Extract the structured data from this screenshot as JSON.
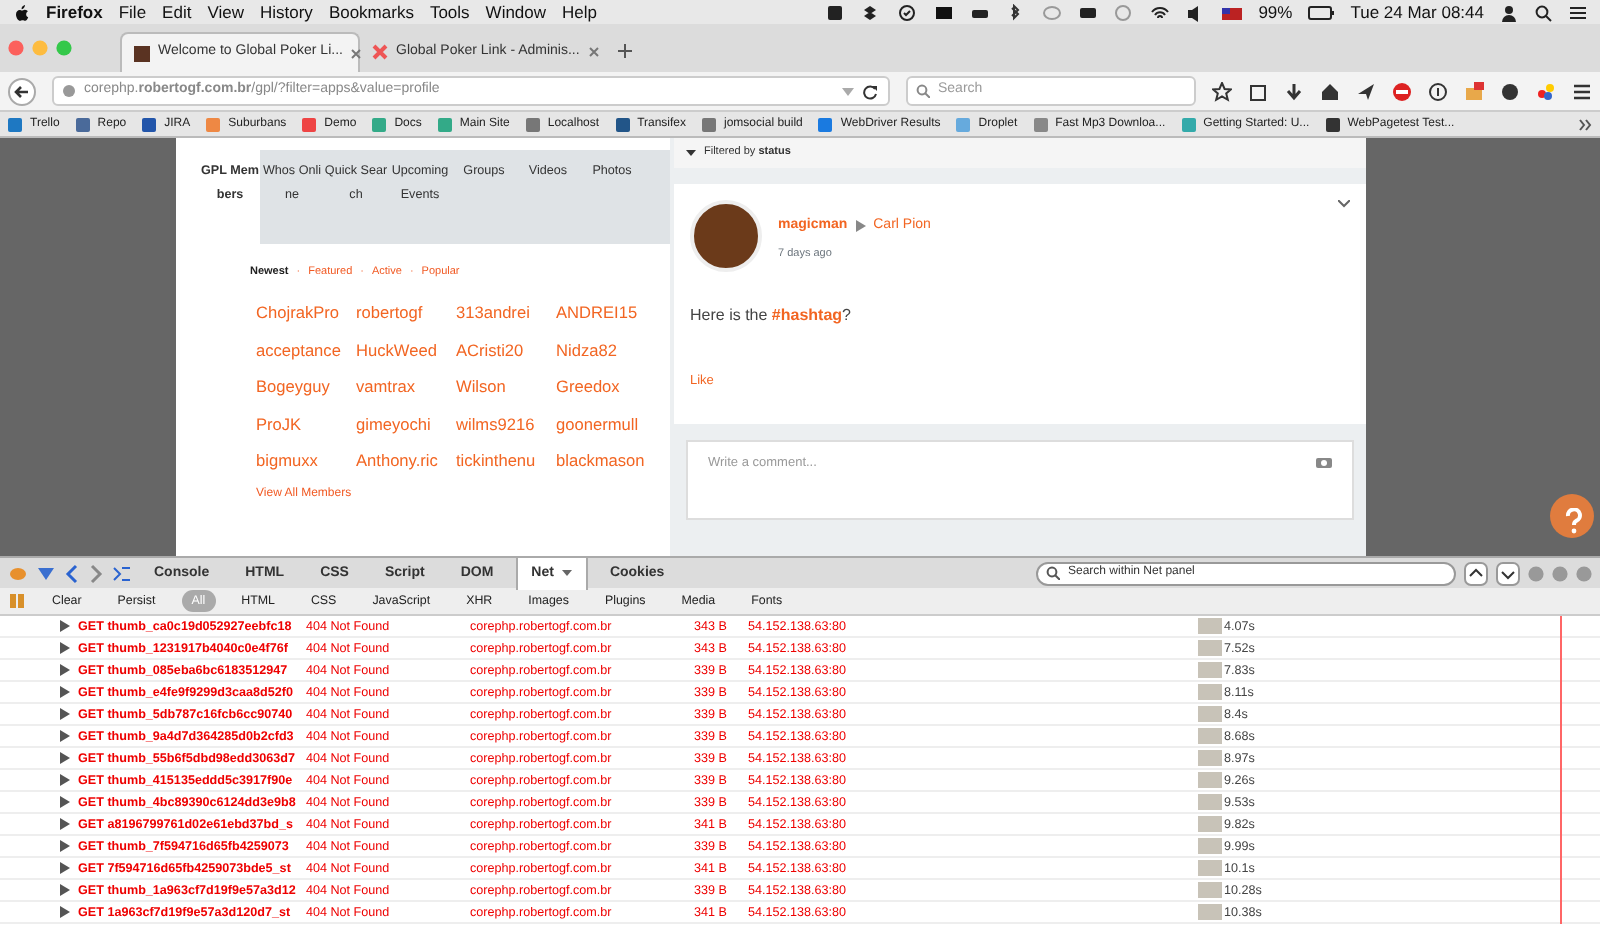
{
  "menu_bar": {
    "app": "Firefox",
    "menus": [
      "File",
      "Edit",
      "View",
      "History",
      "Bookmarks",
      "Tools",
      "Window",
      "Help"
    ],
    "battery": "99%",
    "clock": "Tue 24 Mar  08:44"
  },
  "tabs": [
    {
      "title": "Welcome to Global Poker Li...",
      "selected": true
    },
    {
      "title": "Global Poker Link - Adminis...",
      "selected": false
    }
  ],
  "url_bar": {
    "url": "corephp.**robertogf.com.br**/gpl/?filter=apps&value=profile"
  },
  "search": {
    "placeholder": "Search"
  },
  "bookmarks": [
    "Trello",
    "Repo",
    "JIRA",
    "Suburbans",
    "Demo",
    "Docs",
    "Main Site",
    "Localhost",
    "Transifex",
    "jomsocial build",
    "WebDriver Results",
    "Droplet",
    "Fast Mp3 Downloa...",
    "Getting Started: U...",
    "WebPagetest Test..."
  ],
  "members_panel": {
    "tabs": [
      {
        "label": "GPL Members",
        "selected": true
      },
      {
        "label": "Whos Online",
        "selected": false
      },
      {
        "label": "Quick Search",
        "selected": false
      },
      {
        "label": "Upcoming Events",
        "selected": false
      },
      {
        "label": "Groups",
        "selected": false
      },
      {
        "label": "Videos",
        "selected": false
      },
      {
        "label": "Photos",
        "selected": false
      }
    ],
    "filter_separator": "·",
    "filters": [
      {
        "label": "Newest",
        "selected": true
      },
      {
        "label": "Featured",
        "selected": false
      },
      {
        "label": "Active",
        "selected": false
      },
      {
        "label": "Popular",
        "selected": false
      }
    ],
    "members": [
      "ChojrakPro",
      "robertogf",
      "313andrei",
      "ANDREI15",
      "acceptance",
      "HuckWeed",
      "ACristi20",
      "Nidza82",
      "Bogeyguy",
      "vamtrax",
      "Wilson",
      "Greedox",
      "ProJK",
      "gimeyochi",
      "wilms9216",
      "goonermull",
      "bigmuxx",
      "Anthony.ric",
      "tickinthenu",
      "blackmason"
    ],
    "view_all": "View All Members"
  },
  "feed": {
    "filter_label": "Filtered by **status**",
    "post": {
      "author": "magicman",
      "target": "Carl Pion",
      "time": "7 days ago",
      "text": "Here is the **#hashtag**?",
      "like": "Like"
    },
    "comment_placeholder": "Write a comment..."
  },
  "firebug": {
    "tabs": [
      {
        "label": "Console",
        "selected": false
      },
      {
        "label": "HTML",
        "selected": false
      },
      {
        "label": "CSS",
        "selected": false
      },
      {
        "label": "Script",
        "selected": false
      },
      {
        "label": "DOM",
        "selected": false
      },
      {
        "label": "Net",
        "selected": true
      },
      {
        "label": "Cookies",
        "selected": false
      }
    ],
    "search_placeholder": "Search within Net panel",
    "actions": [
      "Clear",
      "Persist"
    ],
    "types": [
      {
        "label": "All",
        "selected": true
      },
      {
        "label": "HTML",
        "selected": false
      },
      {
        "label": "CSS",
        "selected": false
      },
      {
        "label": "JavaScript",
        "selected": false
      },
      {
        "label": "XHR",
        "selected": false
      },
      {
        "label": "Images",
        "selected": false
      },
      {
        "label": "Plugins",
        "selected": false
      },
      {
        "label": "Media",
        "selected": false
      },
      {
        "label": "Fonts",
        "selected": false
      }
    ]
  },
  "requests": [
    {
      "request": "GET thumb_ca0c19d052927eebfc18",
      "status": "404 Not Found",
      "domain": "corephp.robertogf.com.br",
      "size": "343 B",
      "ip": "54.152.138.63:80",
      "time": "4.07s"
    },
    {
      "request": "GET thumb_1231917b4040c0e4f76f",
      "status": "404 Not Found",
      "domain": "corephp.robertogf.com.br",
      "size": "343 B",
      "ip": "54.152.138.63:80",
      "time": "7.52s"
    },
    {
      "request": "GET thumb_085eba6bc6183512947",
      "status": "404 Not Found",
      "domain": "corephp.robertogf.com.br",
      "size": "339 B",
      "ip": "54.152.138.63:80",
      "time": "7.83s"
    },
    {
      "request": "GET thumb_e4fe9f9299d3caa8d52f0",
      "status": "404 Not Found",
      "domain": "corephp.robertogf.com.br",
      "size": "339 B",
      "ip": "54.152.138.63:80",
      "time": "8.11s"
    },
    {
      "request": "GET thumb_5db787c16fcb6cc90740",
      "status": "404 Not Found",
      "domain": "corephp.robertogf.com.br",
      "size": "339 B",
      "ip": "54.152.138.63:80",
      "time": "8.4s"
    },
    {
      "request": "GET thumb_9a4d7d364285d0b2cfd3",
      "status": "404 Not Found",
      "domain": "corephp.robertogf.com.br",
      "size": "339 B",
      "ip": "54.152.138.63:80",
      "time": "8.68s"
    },
    {
      "request": "GET thumb_55b6f5dbd98edd3063d7",
      "status": "404 Not Found",
      "domain": "corephp.robertogf.com.br",
      "size": "339 B",
      "ip": "54.152.138.63:80",
      "time": "8.97s"
    },
    {
      "request": "GET thumb_415135eddd5c3917f90e",
      "status": "404 Not Found",
      "domain": "corephp.robertogf.com.br",
      "size": "339 B",
      "ip": "54.152.138.63:80",
      "time": "9.26s"
    },
    {
      "request": "GET thumb_4bc89390c6124dd3e9b8",
      "status": "404 Not Found",
      "domain": "corephp.robertogf.com.br",
      "size": "339 B",
      "ip": "54.152.138.63:80",
      "time": "9.53s"
    },
    {
      "request": "GET a8196799761d02e61ebd37bd_s",
      "status": "404 Not Found",
      "domain": "corephp.robertogf.com.br",
      "size": "341 B",
      "ip": "54.152.138.63:80",
      "time": "9.82s"
    },
    {
      "request": "GET thumb_7f594716d65fb4259073",
      "status": "404 Not Found",
      "domain": "corephp.robertogf.com.br",
      "size": "339 B",
      "ip": "54.152.138.63:80",
      "time": "9.99s"
    },
    {
      "request": "GET 7f594716d65fb4259073bde5_st",
      "status": "404 Not Found",
      "domain": "corephp.robertogf.com.br",
      "size": "341 B",
      "ip": "54.152.138.63:80",
      "time": "10.1s"
    },
    {
      "request": "GET thumb_1a963cf7d19f9e57a3d12",
      "status": "404 Not Found",
      "domain": "corephp.robertogf.com.br",
      "size": "339 B",
      "ip": "54.152.138.63:80",
      "time": "10.28s"
    },
    {
      "request": "GET 1a963cf7d19f9e57a3d120d7_st",
      "status": "404 Not Found",
      "domain": "corephp.robertogf.com.br",
      "size": "341 B",
      "ip": "54.152.138.63:80",
      "time": "10.38s"
    }
  ]
}
